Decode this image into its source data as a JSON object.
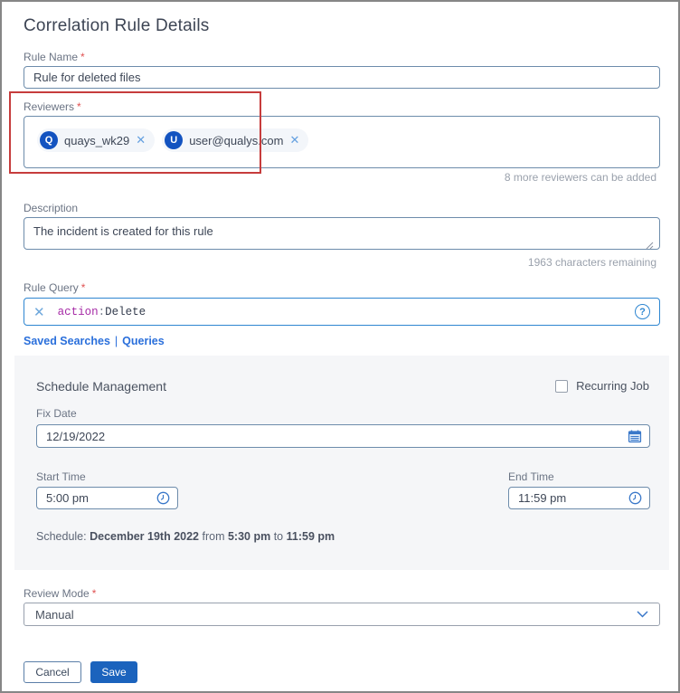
{
  "page": {
    "title": "Correlation Rule Details"
  },
  "icons": {
    "remove": "✕",
    "clear": "✕",
    "help": "?"
  },
  "colors": {
    "accent_blue": "#2a6fdb",
    "avatar_blue": "#1353c0",
    "query_border": "#2e86d1",
    "annotation_red": "#c63c3c",
    "save_blue": "#1b63bd",
    "panel_gray": "#f5f6f8",
    "required_red": "#e05252"
  },
  "rule_name": {
    "label": "Rule Name",
    "required": "*",
    "value": "Rule for deleted files"
  },
  "reviewers": {
    "label": "Reviewers",
    "required": "*",
    "chips": [
      {
        "initial": "Q",
        "name": "quays_wk29"
      },
      {
        "initial": "U",
        "name": "user@qualys.com"
      }
    ],
    "hint": "8 more reviewers can be added"
  },
  "description": {
    "label": "Description",
    "value": "The incident is created for this rule",
    "hint": "1963 characters remaining"
  },
  "rule_query": {
    "label": "Rule Query",
    "required": "*",
    "field": "action",
    "separator": ":",
    "value": "Delete"
  },
  "links": {
    "saved_searches": "Saved Searches",
    "separator": "|",
    "queries": "Queries"
  },
  "schedule": {
    "title": "Schedule Management",
    "recurring_label": "Recurring Job",
    "fix_date": {
      "label": "Fix Date",
      "value": "12/19/2022"
    },
    "start_time": {
      "label": "Start Time",
      "value": "5:00 pm"
    },
    "end_time": {
      "label": "End Time",
      "value": "11:59 pm"
    },
    "summary": {
      "prefix": "Schedule:",
      "date": "December 19th 2022",
      "from_word": "from",
      "start": "5:30 pm",
      "to_word": "to",
      "end": "11:59 pm"
    }
  },
  "review_mode": {
    "label": "Review Mode",
    "required": "*",
    "value": "Manual"
  },
  "actions": {
    "cancel": "Cancel",
    "save": "Save"
  }
}
